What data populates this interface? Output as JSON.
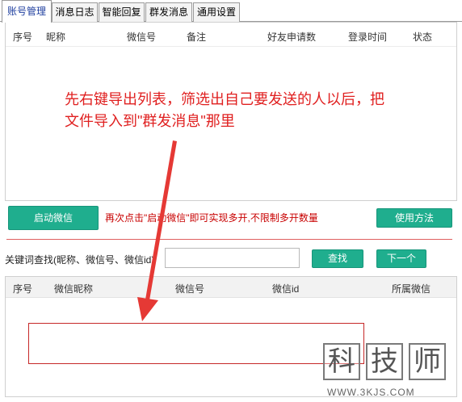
{
  "tabs": [
    {
      "label": "账号管理",
      "active": true
    },
    {
      "label": "消息日志",
      "active": false
    },
    {
      "label": "智能回复",
      "active": false
    },
    {
      "label": "群发消息",
      "active": false
    },
    {
      "label": "通用设置",
      "active": false
    }
  ],
  "accounts_table": {
    "columns": [
      "序号",
      "昵称",
      "微信号",
      "备注",
      "好友申请数",
      "登录时间",
      "状态"
    ]
  },
  "annotation": {
    "line1": "先右键导出列表，筛选出自己要发送的人以后，把",
    "line2": "文件导入到\"群发消息\"那里"
  },
  "toolbar": {
    "start_label": "启动微信",
    "hint": "再次点击\"启动微信\"即可实现多开,不限制多开数量",
    "usage_label": "使用方法"
  },
  "search": {
    "label": "关键词查找(昵称、微信号、微信id)",
    "value": "",
    "find_label": "查找",
    "next_label": "下一个"
  },
  "results_table": {
    "columns": [
      "序号",
      "微信昵称",
      "微信号",
      "微信id",
      "所属微信"
    ]
  },
  "watermark": {
    "chars": [
      "科",
      "技",
      "师"
    ],
    "url": "WWW.3KJS.COM"
  },
  "colors": {
    "accent_green": "#1fae8e",
    "annotation_red": "#e02020",
    "hint_red": "#c80000",
    "active_tab_text": "#1f3f9f"
  }
}
